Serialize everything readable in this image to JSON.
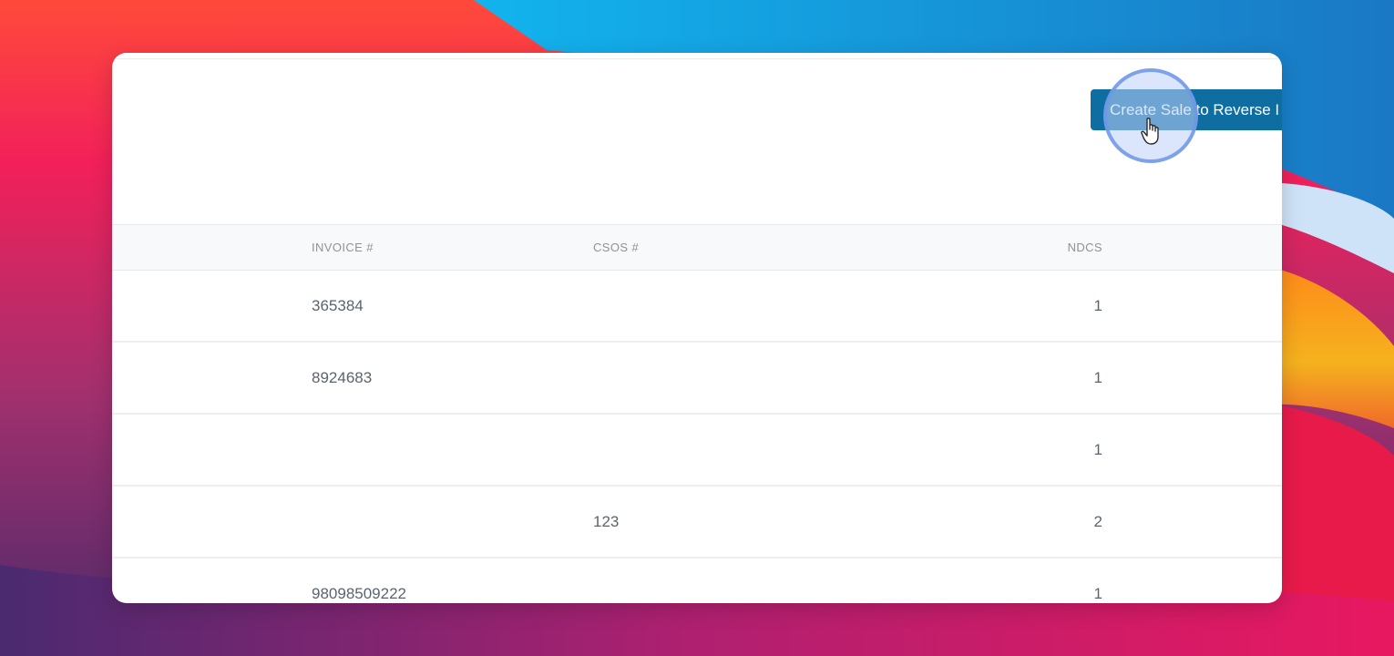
{
  "toolbar": {
    "action_button_label": "Create Sale to Reverse I"
  },
  "table": {
    "headers": {
      "invoice": "INVOICE #",
      "csos": "CSOS #",
      "ndcs": "NDCS"
    },
    "rows": [
      {
        "invoice": "365384",
        "csos": "",
        "ndcs": "1"
      },
      {
        "invoice": "8924683",
        "csos": "",
        "ndcs": "1"
      },
      {
        "invoice": "",
        "csos": "",
        "ndcs": "1"
      },
      {
        "invoice": "",
        "csos": "123",
        "ndcs": "2"
      },
      {
        "invoice": "98098509222",
        "csos": "",
        "ndcs": "1"
      }
    ]
  },
  "colors": {
    "accent": "#0f6ea1",
    "click_highlight": "#6e96e6"
  },
  "icons": {
    "cursor": "hand-pointer-icon"
  }
}
